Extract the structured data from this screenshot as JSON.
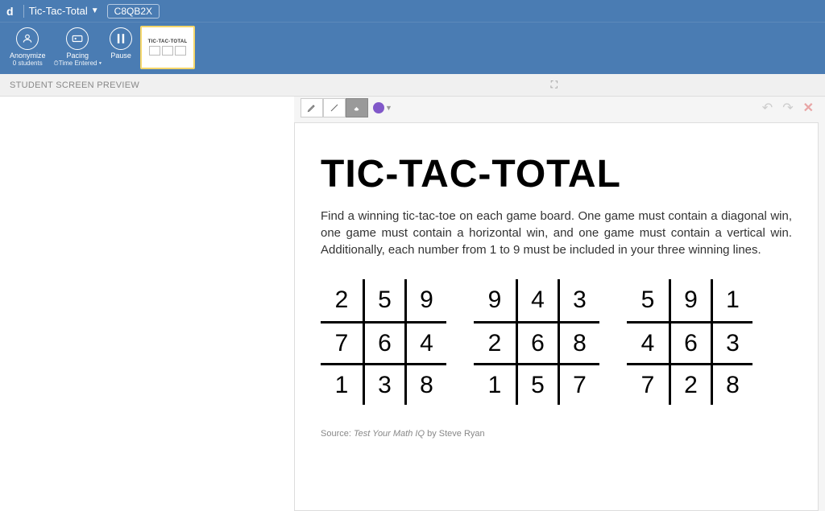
{
  "app": {
    "logo": "d",
    "doc_title": "Tic-Tac-Total",
    "class_code": "C8QB2X"
  },
  "toolbar": {
    "anonymize": {
      "label": "Anonymize",
      "sub": "0 students"
    },
    "pacing": {
      "label": "Pacing",
      "sub": "⏱Time Entered ▾"
    },
    "pause": {
      "label": "Pause",
      "sub": ""
    }
  },
  "thumb": {
    "title": "TIC-TAC-TOTAL"
  },
  "subheader": {
    "label": "STUDENT SCREEN PREVIEW"
  },
  "drawing": {
    "color": "#8158c9"
  },
  "slide": {
    "title": "TIC-TAC-TOTAL",
    "instructions": "Find a winning tic-tac-toe on each game board. One game must contain a diagonal win, one game must contain a horizontal win, and one game must contain a vertical win. Additionally, each number from 1 to 9 must be included in your three winning lines.",
    "boards": [
      [
        [
          "2",
          "5",
          "9"
        ],
        [
          "7",
          "6",
          "4"
        ],
        [
          "1",
          "3",
          "8"
        ]
      ],
      [
        [
          "9",
          "4",
          "3"
        ],
        [
          "2",
          "6",
          "8"
        ],
        [
          "1",
          "5",
          "7"
        ]
      ],
      [
        [
          "5",
          "9",
          "1"
        ],
        [
          "4",
          "6",
          "3"
        ],
        [
          "7",
          "2",
          "8"
        ]
      ]
    ],
    "source_prefix": "Source: ",
    "source_book": "Test Your Math IQ",
    "source_suffix": " by Steve Ryan"
  }
}
